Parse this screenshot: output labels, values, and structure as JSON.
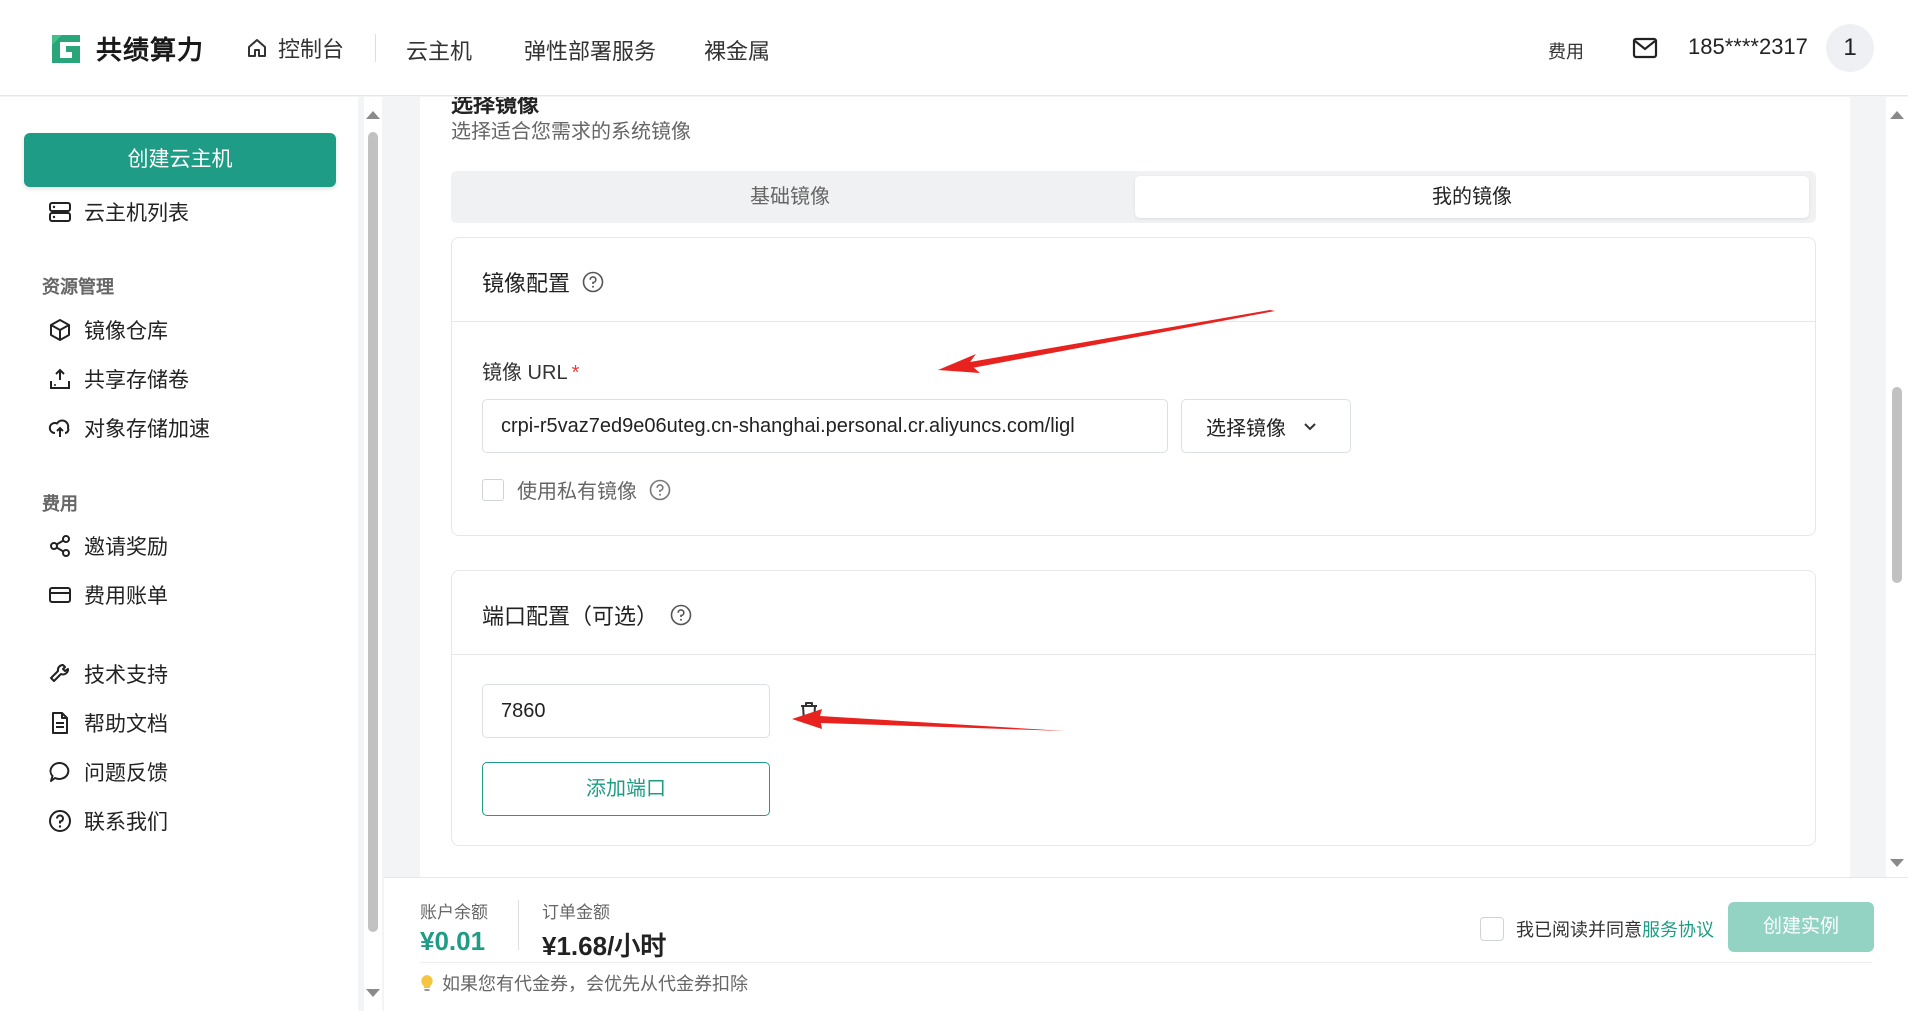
{
  "header": {
    "brand": "共绩算力",
    "nav": {
      "home": "控制台",
      "items": [
        "云主机",
        "弹性部署服务",
        "裸金属"
      ]
    },
    "fee": "费用",
    "phone": "185****2317",
    "avatar_text": "1"
  },
  "sidebar": {
    "create_button": "创建云主机",
    "vm_list": "云主机列表",
    "groups": {
      "resources": "资源管理",
      "billing": "费用"
    },
    "resource_items": [
      "镜像仓库",
      "共享存储卷",
      "对象存储加速"
    ],
    "billing_items": [
      "邀请奖励",
      "费用账单"
    ],
    "support_items": [
      "技术支持",
      "帮助文档",
      "问题反馈",
      "联系我们"
    ]
  },
  "main": {
    "section_title": "选择镜像",
    "section_subtitle": "选择适合您需求的系统镜像",
    "tabs": [
      {
        "label": "基础镜像",
        "active": false
      },
      {
        "label": "我的镜像",
        "active": true
      }
    ],
    "image_config": {
      "title": "镜像配置",
      "url_label": "镜像 URL",
      "required_mark": "*",
      "url_value": "crpi-r5vaz7ed9e06uteg.cn-shanghai.personal.cr.aliyuncs.com/ligl",
      "select_button": "选择镜像",
      "private_checkbox_label": "使用私有镜像",
      "private_checked": false
    },
    "port_config": {
      "title": "端口配置（可选）",
      "ports": [
        "7860"
      ],
      "add_button": "添加端口"
    }
  },
  "footer": {
    "balance_label": "账户余额",
    "balance_value": "¥0.01",
    "order_label": "订单金额",
    "order_value": "¥1.68/小时",
    "agree_prefix": "我已阅读并同意",
    "agree_link": "服务协议",
    "create_button": "创建实例",
    "tip": "如果您有代金券，会优先从代金券扣除"
  },
  "colors": {
    "brand": "#1f9c85",
    "brand_disabled": "#93d3c4",
    "arrow": "#e8231f"
  }
}
